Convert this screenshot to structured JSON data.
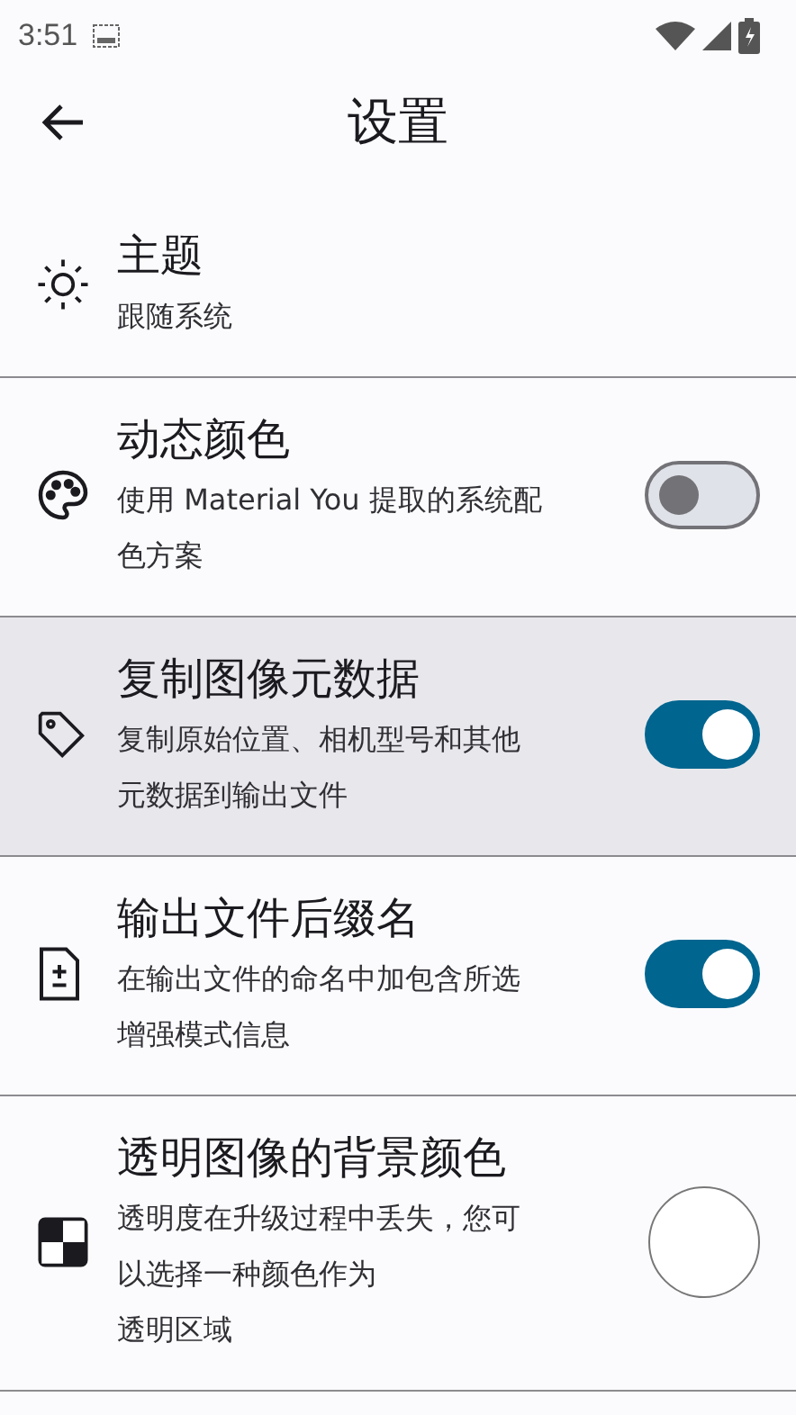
{
  "status_bar": {
    "time": "3:51"
  },
  "header": {
    "title": "设置"
  },
  "settings": [
    {
      "kind": "value",
      "title": "主题",
      "description": [
        "跟随系统"
      ],
      "highlighted": false
    },
    {
      "kind": "switch",
      "title": "动态颜色",
      "description": [
        "使用 Material You 提取的系统配",
        "色方案"
      ],
      "on": false,
      "highlighted": false
    },
    {
      "kind": "switch",
      "title": "复制图像元数据",
      "description": [
        "复制原始位置、相机型号和其他",
        "元数据到输出文件"
      ],
      "on": true,
      "highlighted": true
    },
    {
      "kind": "switch",
      "title": "输出文件后缀名",
      "description": [
        "在输出文件的命名中加包含所选",
        "增强模式信息"
      ],
      "on": true,
      "highlighted": false
    },
    {
      "kind": "color",
      "title": "透明图像的背景颜色",
      "description": [
        "透明度在升级过程中丢失，您可",
        "以选择一种颜色作为",
        "透明区域"
      ],
      "highlighted": false
    }
  ]
}
